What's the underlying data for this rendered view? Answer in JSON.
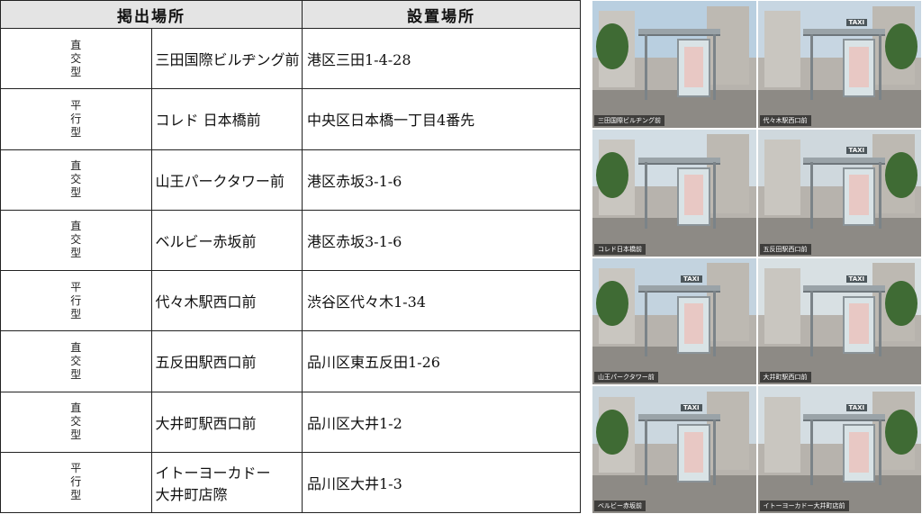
{
  "table": {
    "headers": {
      "location": "掲出場所",
      "address": "設置場所"
    },
    "rows": [
      {
        "type": [
          "直",
          "交",
          "型"
        ],
        "location_line1": "三田国際ビルヂング前",
        "location_line2": "",
        "address": "港区三田1-4-28"
      },
      {
        "type": [
          "平",
          "行",
          "型"
        ],
        "location_line1": "コレド 日本橋前",
        "location_line2": "",
        "address": "中央区日本橋一丁目4番先"
      },
      {
        "type": [
          "直",
          "交",
          "型"
        ],
        "location_line1": "山王パークタワー前",
        "location_line2": "",
        "address": "港区赤坂3-1-6"
      },
      {
        "type": [
          "直",
          "交",
          "型"
        ],
        "location_line1": "ベルビー赤坂前",
        "location_line2": "",
        "address": "港区赤坂3-1-6"
      },
      {
        "type": [
          "平",
          "行",
          "型"
        ],
        "location_line1": "代々木駅西口前",
        "location_line2": "",
        "address": "渋谷区代々木1-34"
      },
      {
        "type": [
          "直",
          "交",
          "型"
        ],
        "location_line1": "五反田駅西口前",
        "location_line2": "",
        "address": "品川区東五反田1-26"
      },
      {
        "type": [
          "直",
          "交",
          "型"
        ],
        "location_line1": "大井町駅西口前",
        "location_line2": "",
        "address": "品川区大井1-2"
      },
      {
        "type": [
          "平",
          "行",
          "型"
        ],
        "location_line1": "イトーヨーカドー",
        "location_line2": "大井町店際",
        "address": "品川区大井1-3"
      }
    ]
  },
  "photos": {
    "taxi_sign": "TAXI",
    "items": [
      {
        "caption": "三田国際ビルヂング前"
      },
      {
        "caption": "代々木駅西口前"
      },
      {
        "caption": "コレド日本橋前"
      },
      {
        "caption": "五反田駅西口前"
      },
      {
        "caption": "山王パークタワー前"
      },
      {
        "caption": "大井町駅西口前"
      },
      {
        "caption": "ベルビー赤坂前"
      },
      {
        "caption": "イトーヨーカドー大井町店前"
      }
    ]
  }
}
